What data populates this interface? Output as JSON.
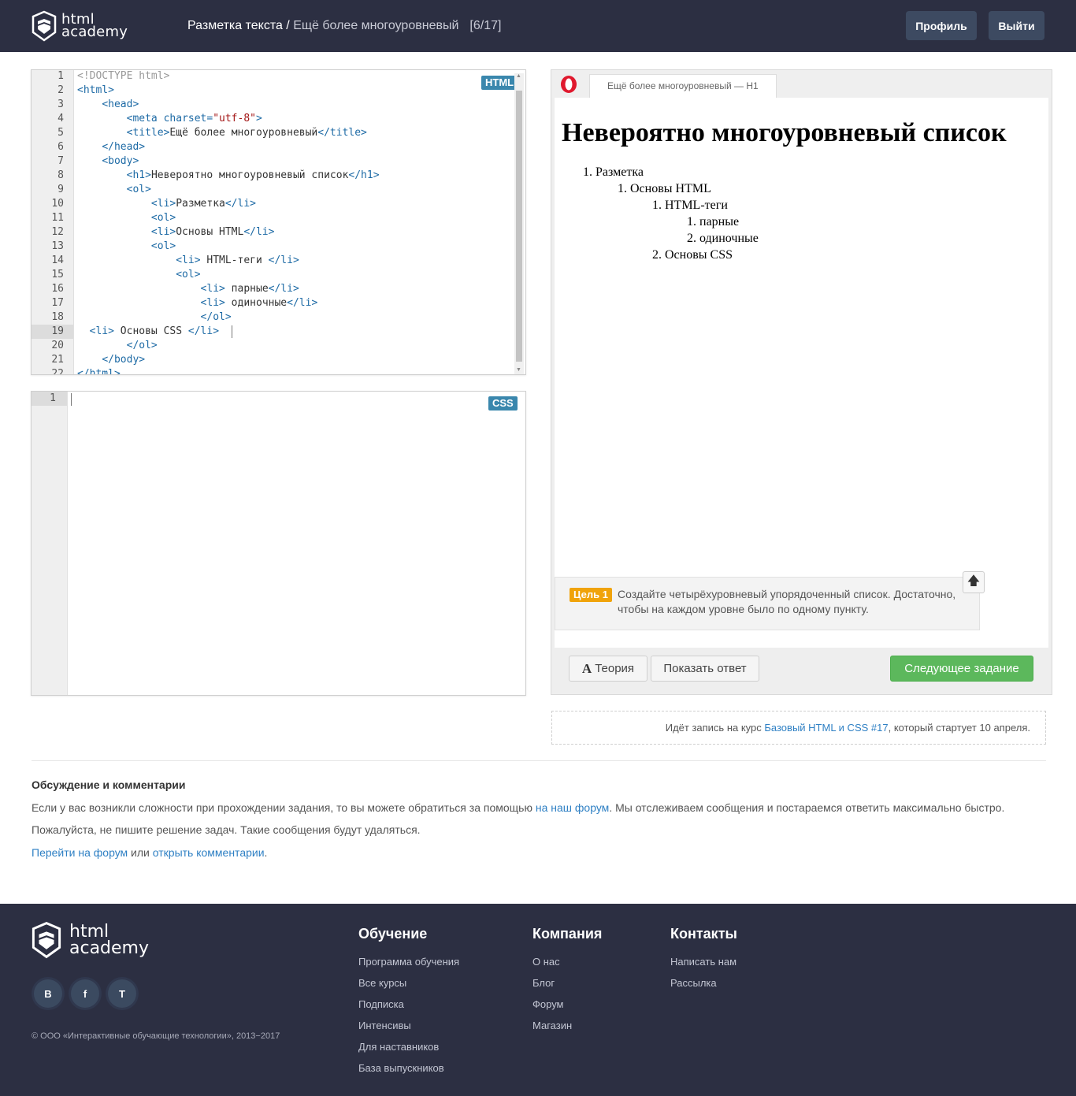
{
  "header": {
    "logo_line1": "html",
    "logo_line2": "academy",
    "breadcrumb_section": "Разметка текста",
    "breadcrumb_sep": " / ",
    "breadcrumb_current": "Ещё более многоуровневый",
    "progress": "[6/17]",
    "profile_label": "Профиль",
    "logout_label": "Выйти"
  },
  "html_editor": {
    "badge": "HTML",
    "active_line": 19,
    "lines": [
      {
        "n": "1",
        "indent": "",
        "parts": [
          [
            "faded",
            "<!DOCTYPE html>"
          ]
        ]
      },
      {
        "n": "2",
        "indent": "",
        "parts": [
          [
            "tag",
            "<html>"
          ]
        ]
      },
      {
        "n": "3",
        "indent": "    ",
        "parts": [
          [
            "tag",
            "<head>"
          ]
        ]
      },
      {
        "n": "4",
        "indent": "        ",
        "parts": [
          [
            "tag",
            "<meta charset="
          ],
          [
            "str",
            "\"utf-8\""
          ],
          [
            "tag",
            ">"
          ]
        ]
      },
      {
        "n": "5",
        "indent": "        ",
        "parts": [
          [
            "tag",
            "<title>"
          ],
          [
            "txt",
            "Ещё более многоуровневый"
          ],
          [
            "tag",
            "</title>"
          ]
        ]
      },
      {
        "n": "6",
        "indent": "    ",
        "parts": [
          [
            "tag",
            "</head>"
          ]
        ]
      },
      {
        "n": "7",
        "indent": "    ",
        "parts": [
          [
            "tag",
            "<body>"
          ]
        ]
      },
      {
        "n": "8",
        "indent": "        ",
        "parts": [
          [
            "tag",
            "<h1>"
          ],
          [
            "txt",
            "Невероятно многоуровневый список"
          ],
          [
            "tag",
            "</h1>"
          ]
        ]
      },
      {
        "n": "9",
        "indent": "        ",
        "parts": [
          [
            "tag",
            "<ol>"
          ]
        ]
      },
      {
        "n": "10",
        "indent": "            ",
        "parts": [
          [
            "tag",
            "<li>"
          ],
          [
            "txt",
            "Разметка"
          ],
          [
            "tag",
            "</li>"
          ]
        ]
      },
      {
        "n": "11",
        "indent": "            ",
        "parts": [
          [
            "tag",
            "<ol>"
          ]
        ]
      },
      {
        "n": "12",
        "indent": "            ",
        "parts": [
          [
            "tag",
            "<li>"
          ],
          [
            "txt",
            "Основы HTML"
          ],
          [
            "tag",
            "</li>"
          ]
        ]
      },
      {
        "n": "13",
        "indent": "            ",
        "parts": [
          [
            "tag",
            "<ol>"
          ]
        ]
      },
      {
        "n": "14",
        "indent": "                ",
        "parts": [
          [
            "tag",
            "<li>"
          ],
          [
            "txt",
            " HTML-теги "
          ],
          [
            "tag",
            "</li>"
          ]
        ]
      },
      {
        "n": "15",
        "indent": "                ",
        "parts": [
          [
            "tag",
            "<ol>"
          ]
        ]
      },
      {
        "n": "16",
        "indent": "                    ",
        "parts": [
          [
            "tag",
            "<li>"
          ],
          [
            "txt",
            " парные"
          ],
          [
            "tag",
            "</li>"
          ]
        ]
      },
      {
        "n": "17",
        "indent": "                    ",
        "parts": [
          [
            "tag",
            "<li>"
          ],
          [
            "txt",
            " одиночные"
          ],
          [
            "tag",
            "</li>"
          ]
        ]
      },
      {
        "n": "18",
        "indent": "                    ",
        "parts": [
          [
            "tag",
            "</ol>"
          ]
        ]
      },
      {
        "n": "19",
        "indent": "  ",
        "parts": [
          [
            "tag",
            "<li>"
          ],
          [
            "txt",
            " Основы CSS "
          ],
          [
            "tag",
            "</li>"
          ]
        ]
      },
      {
        "n": "20",
        "indent": "        ",
        "parts": [
          [
            "tag",
            "</ol>"
          ]
        ]
      },
      {
        "n": "21",
        "indent": "    ",
        "parts": [
          [
            "tag",
            "</body>"
          ]
        ]
      },
      {
        "n": "22",
        "indent": "",
        "parts": [
          [
            "tag",
            "</html>"
          ]
        ]
      }
    ]
  },
  "css_editor": {
    "badge": "CSS",
    "line_number": "1"
  },
  "preview": {
    "tab_title": "Ещё более многоуровневый — Н1",
    "h1": "Невероятно многоуровневый список",
    "items": [
      {
        "num": "1.",
        "text": "Разметка",
        "level": 0
      },
      {
        "num": "1.",
        "text": "Основы HTML",
        "level": 1
      },
      {
        "num": "1.",
        "text": "HTML-теги",
        "level": 2
      },
      {
        "num": "1.",
        "text": "парные",
        "level": 3
      },
      {
        "num": "2.",
        "text": "одиночные",
        "level": 3
      },
      {
        "num": "2.",
        "text": "Основы CSS",
        "level": 2
      }
    ],
    "task_badge": "Цель 1",
    "task_text": "Создайте четырёхуровневый упорядоченный список. Достаточно, чтобы на каждом уровне было по одному пункту.",
    "up_icon": "arrow-up-icon",
    "theory_label": "Теория",
    "show_answer_label": "Показать ответ",
    "next_label": "Следующее задание"
  },
  "enroll": {
    "prefix": "Идёт запись на курс ",
    "course_link": "Базовый HTML и CSS #17",
    "suffix": ", который стартует 10 апреля."
  },
  "discussion": {
    "title": "Обсуждение и комментарии",
    "p1_prefix": "Если у вас возникли сложности при прохождении задания, то вы можете обратиться за помощью ",
    "p1_link": "на наш форум",
    "p1_suffix": ". Мы отслеживаем сообщения и постараемся ответить максимально быстро.",
    "p2": "Пожалуйста, не пишите решение задач. Такие сообщения будут удаляться.",
    "forum_link": "Перейти на форум",
    "or_text": " или ",
    "comments_link": "открыть комментарии",
    "dot": "."
  },
  "footer": {
    "logo_line1": "html",
    "logo_line2": "academy",
    "social": [
      "В",
      "f",
      "T"
    ],
    "copyright": "© ООО «Интерактивные обучающие технологии», 2013−2017",
    "columns": [
      {
        "title": "Обучение",
        "links": [
          "Программа обучения",
          "Все курсы",
          "Подписка",
          "Интенсивы",
          "Для наставников",
          "База выпускников"
        ]
      },
      {
        "title": "Компания",
        "links": [
          "О нас",
          "Блог",
          "Форум",
          "Магазин"
        ]
      },
      {
        "title": "Контакты",
        "links": [
          "Написать нам",
          "Рассылка"
        ]
      }
    ]
  },
  "colors": {
    "header_bg": "#2c2f42",
    "link": "#2f80c4",
    "next_button": "#5cb85c",
    "task_badge": "#f0a30a",
    "lang_badge": "#3a87ad"
  }
}
